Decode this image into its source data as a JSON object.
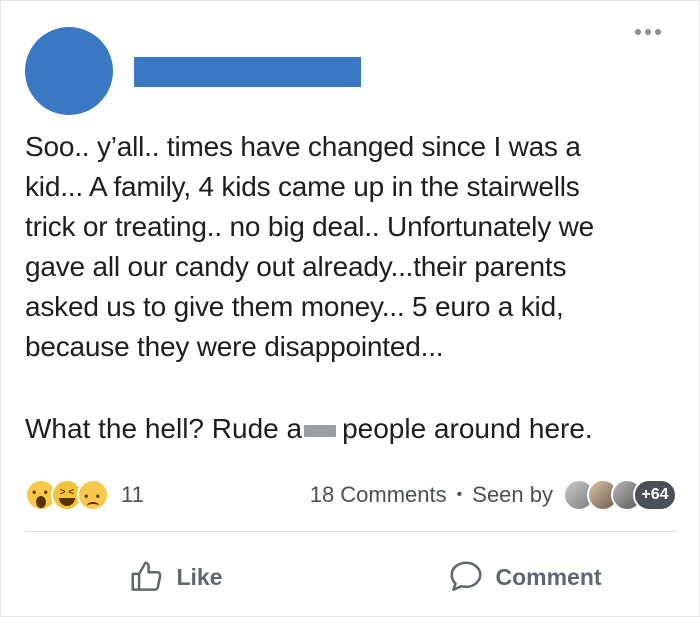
{
  "post": {
    "text_lines": [
      "Soo.. y’all.. times have changed since I was a",
      "kid... A family, 4 kids came up in the stairwells",
      "trick or treating.. no big deal.. Unfortunately we",
      "gave all our candy out already...their parents",
      "asked us to give them money... 5 euro a kid,",
      "because they were disappointed..."
    ],
    "text2_before": "What the hell? Rude a",
    "text2_after": " people around here."
  },
  "stats": {
    "reaction_count": "11",
    "comments": "18 Comments",
    "separator": "•",
    "seen_by": "Seen by",
    "seen_more": "+64"
  },
  "actions": {
    "like": "Like",
    "comment": "Comment"
  },
  "colors": {
    "avatar": "#3b78c4",
    "text": "#1c1e21",
    "muted": "#606770"
  }
}
